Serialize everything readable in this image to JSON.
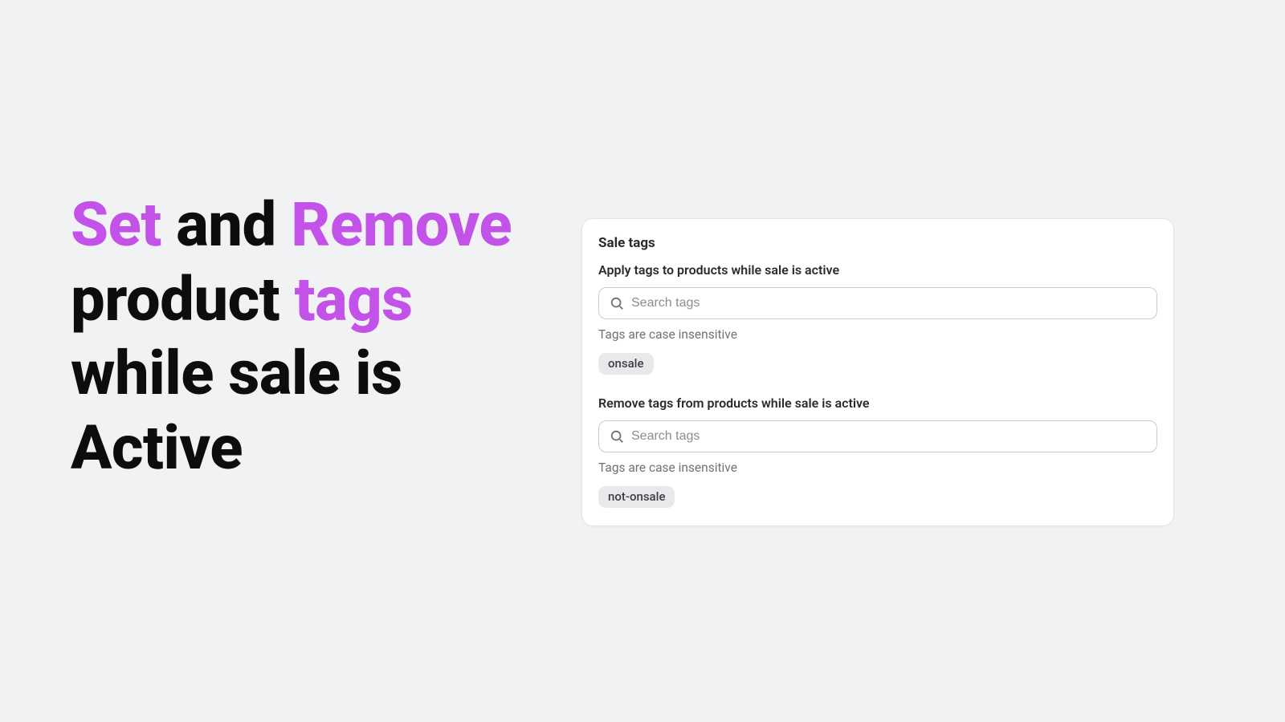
{
  "headline": {
    "w1": "Set",
    "w2": " and ",
    "w3": "Remove",
    "w4": " product ",
    "w5": "tags",
    "w6": " while sale is Active"
  },
  "card": {
    "title": "Sale tags",
    "apply": {
      "label": "Apply tags to products while sale is active",
      "placeholder": "Search tags",
      "hint": "Tags are case insensitive",
      "tags": [
        "onsale"
      ]
    },
    "remove": {
      "label": "Remove tags from products while sale is active",
      "placeholder": "Search tags",
      "hint": "Tags are case insensitive",
      "tags": [
        "not-onsale"
      ]
    }
  }
}
